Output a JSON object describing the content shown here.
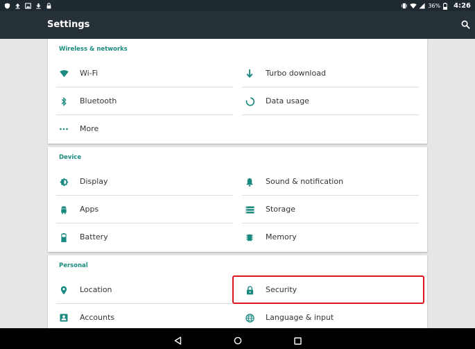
{
  "status_bar": {
    "battery_percent": "36%",
    "time": "4:26",
    "icons_left": [
      "shield-icon",
      "upload-icon",
      "image-icon",
      "download-icon",
      "lock-icon"
    ],
    "icons_right": [
      "vibrate-icon",
      "wifi-icon",
      "signal-icon",
      "battery-icon"
    ]
  },
  "app_bar": {
    "title": "Settings"
  },
  "sections": {
    "wireless": {
      "header": "Wireless & networks",
      "items": [
        {
          "label": "Wi-Fi",
          "icon": "wifi-icon"
        },
        {
          "label": "Turbo download",
          "icon": "download-arrow-icon"
        },
        {
          "label": "Bluetooth",
          "icon": "bluetooth-icon"
        },
        {
          "label": "Data usage",
          "icon": "data-usage-icon"
        },
        {
          "label": "More",
          "icon": "more-dots-icon"
        }
      ]
    },
    "device": {
      "header": "Device",
      "items": [
        {
          "label": "Display",
          "icon": "brightness-icon"
        },
        {
          "label": "Sound & notification",
          "icon": "bell-icon"
        },
        {
          "label": "Apps",
          "icon": "android-icon"
        },
        {
          "label": "Storage",
          "icon": "storage-icon"
        },
        {
          "label": "Battery",
          "icon": "battery-icon"
        },
        {
          "label": "Memory",
          "icon": "memory-icon"
        }
      ]
    },
    "personal": {
      "header": "Personal",
      "items": [
        {
          "label": "Location",
          "icon": "location-pin-icon"
        },
        {
          "label": "Security",
          "icon": "lock-icon"
        },
        {
          "label": "Accounts",
          "icon": "account-icon"
        },
        {
          "label": "Language & input",
          "icon": "globe-icon"
        }
      ]
    }
  },
  "colors": {
    "accent": "#1a8a80",
    "app_bar": "#263238",
    "highlight": "#e0141e"
  }
}
